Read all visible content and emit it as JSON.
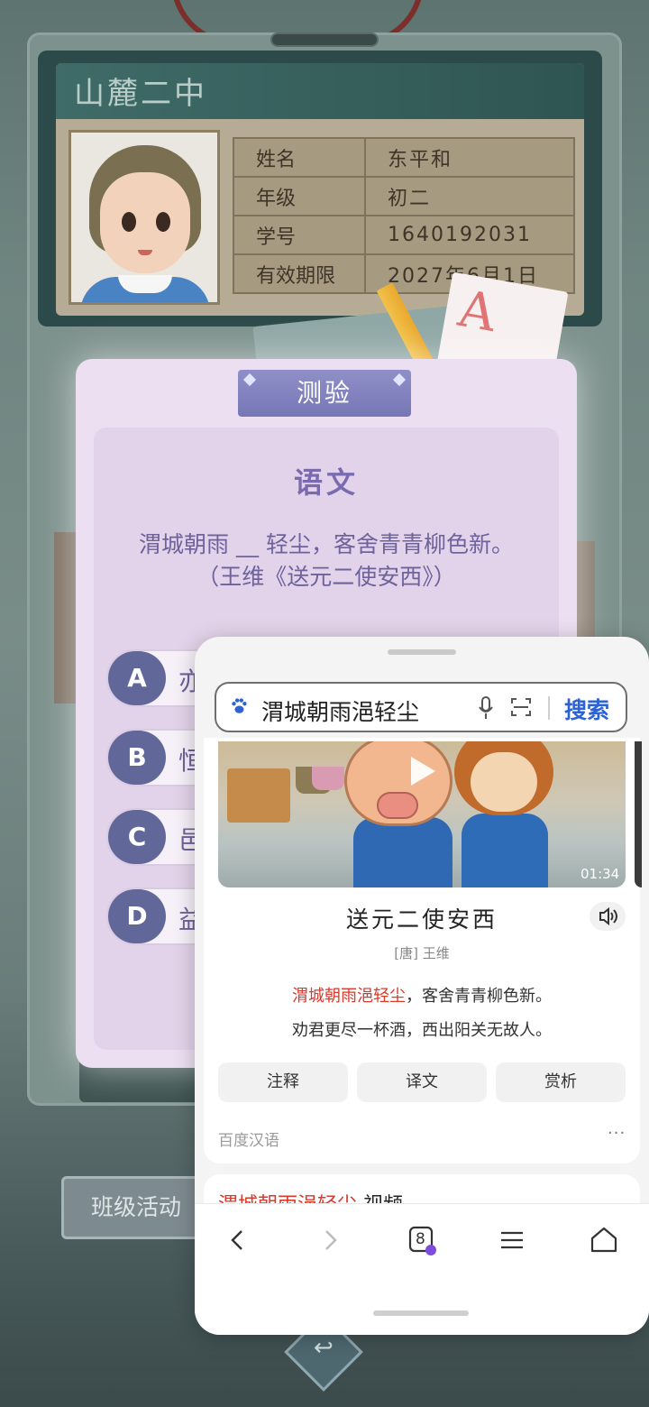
{
  "game": {
    "school_name": "山麓二中",
    "info": [
      {
        "label": "姓名",
        "value": "东平和"
      },
      {
        "label": "年级",
        "value": "初二"
      },
      {
        "label": "学号",
        "value": "1640192031"
      },
      {
        "label": "有效期限",
        "value": "2027年6月1日"
      }
    ],
    "paper_mark": "A",
    "quiz": {
      "tab_label": "测验",
      "subject": "语文",
      "question_line1": "渭城朝雨 __ 轻尘，客舍青青柳色新。",
      "question_line2": "（王维《送元二使安西》）",
      "options": [
        {
          "letter": "A",
          "text": "亦"
        },
        {
          "letter": "B",
          "text": "恒"
        },
        {
          "letter": "C",
          "text": "邑"
        },
        {
          "letter": "D",
          "text": "益"
        }
      ]
    },
    "class_activity_button": "班级活动"
  },
  "browser": {
    "search_query": "渭城朝雨浥轻尘",
    "search_button": "搜索",
    "video_duration": "01:34",
    "poem": {
      "title": "送元二使安西",
      "author": "[唐] 王维",
      "line1_highlight": "渭城朝雨浥轻尘",
      "line1_rest": "，客舍青青柳色新。",
      "line2": "劝君更尽一杯酒，西出阳关无故人。"
    },
    "tabs": [
      "注释",
      "译文",
      "赏析"
    ],
    "source": "百度汉语",
    "more": "···",
    "next_result_highlight": "渭城朝雨浥轻尘",
    "next_result_rest": " 视频",
    "tab_count": "8"
  },
  "icons": {
    "search_engine": "paw-icon",
    "mic": "microphone-icon",
    "scan": "scan-icon",
    "speaker": "speaker-icon",
    "play": "play-icon",
    "back": "chevron-left-icon",
    "forward": "chevron-right-icon",
    "tabs": "tabs-icon",
    "menu": "menu-icon",
    "home": "home-icon"
  },
  "colors": {
    "highlight": "#d83a2c",
    "search_button": "#2d62d6",
    "quiz_accent": "#626799"
  }
}
